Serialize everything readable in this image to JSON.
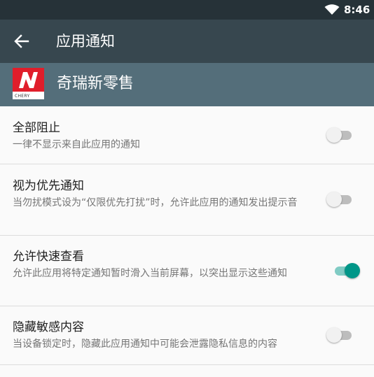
{
  "status_bar": {
    "time": "8:46",
    "wifi_icon": "wifi-icon"
  },
  "toolbar": {
    "back_icon": "back-arrow-icon",
    "title": "应用通知"
  },
  "app_header": {
    "name": "奇瑞新零售",
    "logo_text": "CHERY",
    "logo_colors": {
      "background": "#e01e2b",
      "band": "#ffffff"
    }
  },
  "colors": {
    "status_bar": "#263238",
    "toolbar": "#37474f",
    "app_header": "#546e7a",
    "accent": "#009688"
  },
  "settings": [
    {
      "title": "全部阻止",
      "summary": "一律不显示来自此应用的通知",
      "checked": false
    },
    {
      "title": "视为优先通知",
      "summary": "当勿扰模式设为“仅限优先打扰”时，允许此应用的通知发出提示音",
      "checked": false
    },
    {
      "title": "允许快速查看",
      "summary": "允许此应用将特定通知暂时滑入当前屏幕，以突出显示这些通知",
      "checked": true
    },
    {
      "title": "隐藏敏感内容",
      "summary": "当设备锁定时，隐藏此应用通知中可能会泄露隐私信息的内容",
      "checked": false
    }
  ]
}
